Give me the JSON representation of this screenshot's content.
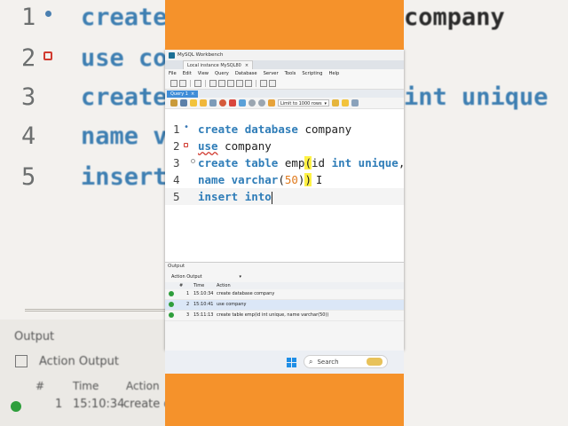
{
  "background": {
    "line_numbers": [
      "1",
      "2",
      "3",
      "4",
      "5"
    ],
    "left_code": [
      "create",
      "use co",
      "create",
      "name v",
      "insert"
    ],
    "right_code": [
      "company",
      "",
      "int unique",
      "",
      ""
    ],
    "output_label": "Output",
    "action_output_label": "Action Output",
    "col_number": "#",
    "col_time": "Time",
    "col_action": "Action",
    "row1_num": "1",
    "row1_time": "15:10:34",
    "row1_action": "create d",
    "orange": "#f5922b"
  },
  "window": {
    "app_title": "MySQL Workbench",
    "connection_tab": "Local instance MySQL80",
    "close_glyph": "×",
    "menu": [
      "File",
      "Edit",
      "View",
      "Query",
      "Database",
      "Server",
      "Tools",
      "Scripting",
      "Help"
    ],
    "query_tab": "Query 1",
    "limit_label": "Limit to 1000 rows"
  },
  "editor": {
    "line_numbers": [
      "1",
      "2",
      "3",
      "4",
      "5"
    ],
    "line1": [
      "create",
      "database",
      "company"
    ],
    "line2": [
      "use",
      "company"
    ],
    "line3": [
      "create",
      "table",
      "emp",
      "(",
      "id",
      "int",
      "unique",
      ","
    ],
    "line4": [
      "name",
      "varchar",
      "(",
      "50",
      ")",
      ")"
    ],
    "line5": [
      "insert",
      "into"
    ],
    "ibeam": "I"
  },
  "output": {
    "title": "Output",
    "mode": "Action Output",
    "columns": [
      "#",
      "Time",
      "Action"
    ],
    "rows": [
      {
        "num": "1",
        "time": "15:10:34",
        "action": "create database company"
      },
      {
        "num": "2",
        "time": "15:10:41",
        "action": "use company"
      },
      {
        "num": "3",
        "time": "15:11:13",
        "action": "create table emp(id int unique, name varchar(50))"
      }
    ]
  },
  "taskbar": {
    "search_placeholder": "Search"
  }
}
